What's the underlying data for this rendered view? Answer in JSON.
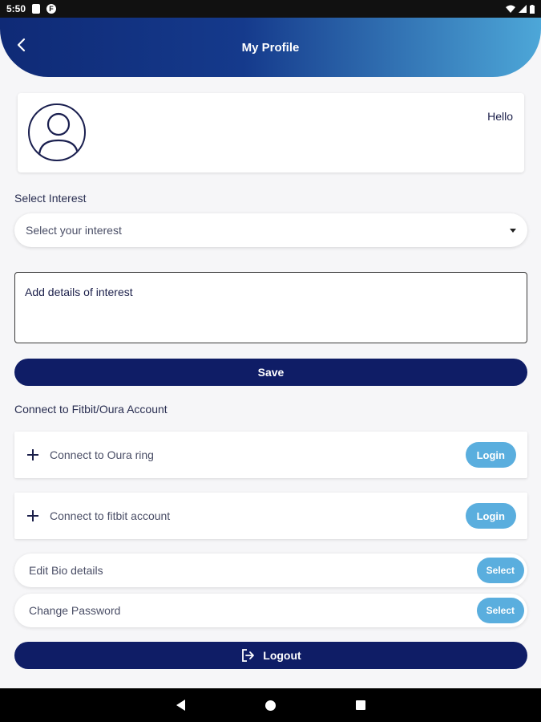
{
  "status_bar": {
    "time": "5:50",
    "f_badge": "F"
  },
  "header": {
    "title": "My Profile"
  },
  "profile": {
    "greeting": "Hello"
  },
  "interest": {
    "label": "Select Interest",
    "select_placeholder": "Select your interest",
    "details_placeholder": "Add details of interest",
    "save_label": "Save"
  },
  "connect": {
    "label": "Connect to Fitbit/Oura Account",
    "oura": {
      "text": "Connect to Oura ring",
      "button": "Login"
    },
    "fitbit": {
      "text": "Connect to fitbit account",
      "button": "Login"
    }
  },
  "bio": {
    "text": "Edit Bio details",
    "button": "Select"
  },
  "password": {
    "text": "Change Password",
    "button": "Select"
  },
  "logout": {
    "label": "Logout"
  },
  "colors": {
    "primary": "#0f1d66",
    "accent": "#5aaede",
    "header_start": "#0f2a76",
    "header_end": "#4da7d8"
  }
}
